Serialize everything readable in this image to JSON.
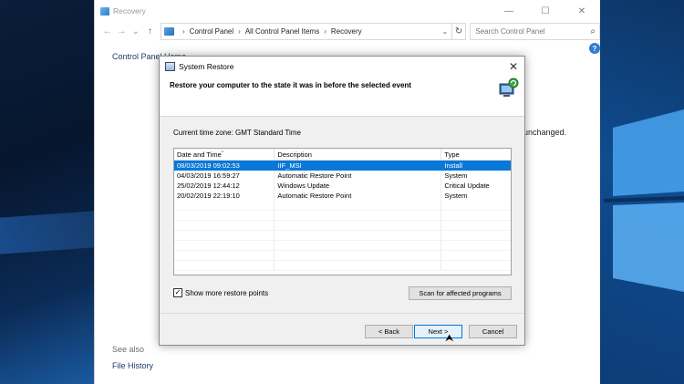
{
  "explorer": {
    "title": "Recovery",
    "window_controls": {
      "minimize": "—",
      "maximize": "☐",
      "close": "✕"
    },
    "nav": {
      "back": "←",
      "forward": "→",
      "recent": "⌄",
      "up": "↑"
    },
    "breadcrumb": [
      "Control Panel",
      "All Control Panel Items",
      "Recovery"
    ],
    "search_placeholder": "Search Control Panel",
    "help": "?",
    "left_link": "Control Panel Home",
    "background_text": "unchanged.",
    "see_also": "See also",
    "file_history": "File History"
  },
  "dialog": {
    "title": "System Restore",
    "close": "✕",
    "heading": "Restore your computer to the state it was in before the selected event",
    "timezone": "Current time zone: GMT Standard Time",
    "columns": [
      "Date and Time",
      "Description",
      "Type"
    ],
    "rows": [
      {
        "date": "08/03/2019 09:02:53",
        "description": "IIF_MSI",
        "type": "Install",
        "selected": true
      },
      {
        "date": "04/03/2019 16:59:27",
        "description": "Automatic Restore Point",
        "type": "System",
        "selected": false
      },
      {
        "date": "25/02/2019 12:44:12",
        "description": "Windows Update",
        "type": "Critical Update",
        "selected": false
      },
      {
        "date": "20/02/2019 22:19:10",
        "description": "Automatic Restore Point",
        "type": "System",
        "selected": false
      }
    ],
    "show_more_label": "Show more restore points",
    "show_more_checked": true,
    "scan_button": "Scan for affected programs",
    "back_button": "< Back",
    "next_button": "Next >",
    "cancel_button": "Cancel"
  },
  "colors": {
    "selection": "#0a78d7",
    "link": "#1c3c6c",
    "accent": "#0078d7"
  }
}
